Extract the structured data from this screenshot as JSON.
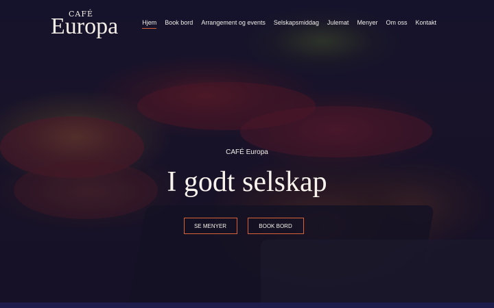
{
  "brand": {
    "small": "CAFÉ",
    "big": "Europa"
  },
  "nav": {
    "items": [
      {
        "label": "Hjem",
        "active": true
      },
      {
        "label": "Book bord",
        "active": false
      },
      {
        "label": "Arrangement og events",
        "active": false
      },
      {
        "label": "Selskapsmiddag",
        "active": false
      },
      {
        "label": "Julemat",
        "active": false
      },
      {
        "label": "Menyer",
        "active": false
      },
      {
        "label": "Om oss",
        "active": false
      },
      {
        "label": "Kontakt",
        "active": false
      }
    ]
  },
  "hero": {
    "eyebrow": "CAFÉ Europa",
    "headline": "I godt selskap",
    "buttons": {
      "menus": "SE MENYER",
      "book": "BOOK BORD"
    }
  },
  "colors": {
    "accent": "#d9643a",
    "overlay": "#15132c"
  }
}
